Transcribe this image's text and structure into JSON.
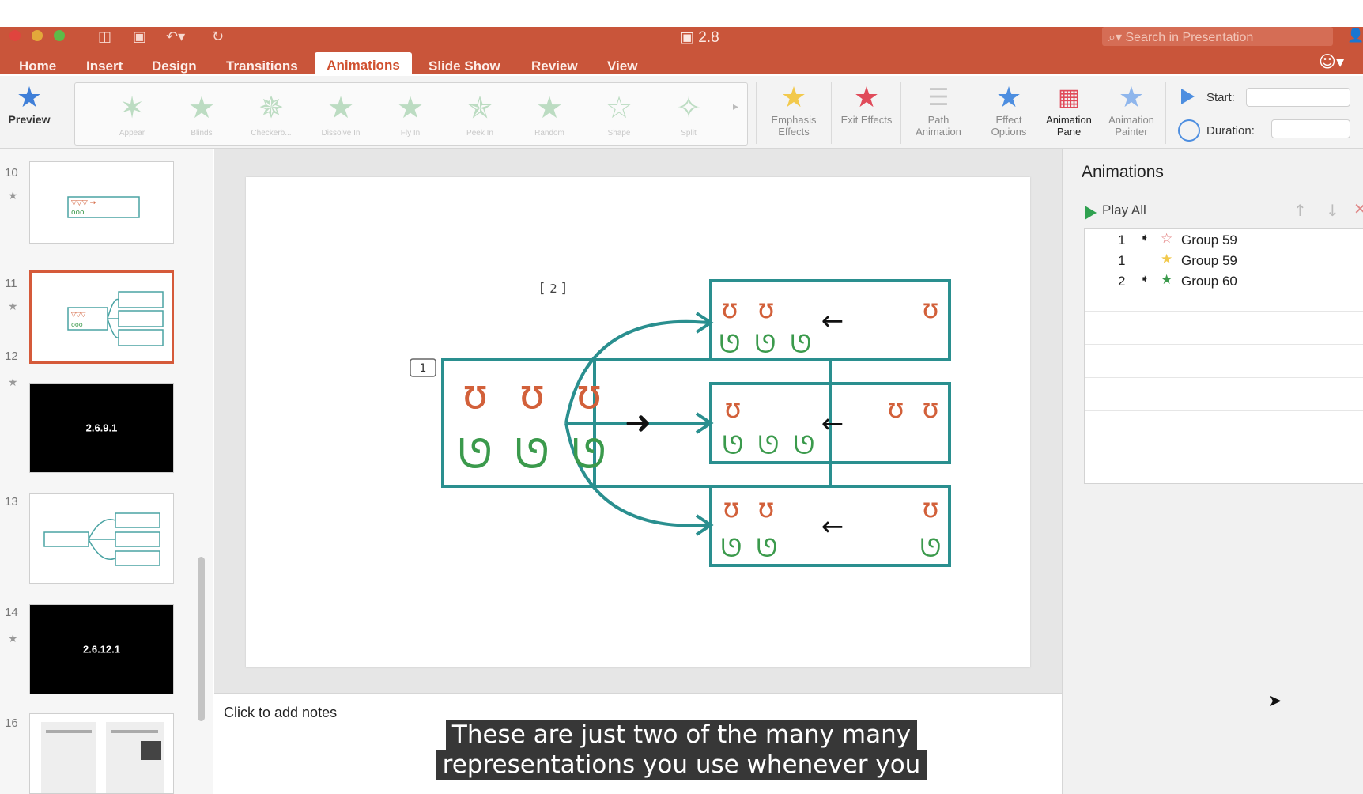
{
  "window": {
    "title": "2.8",
    "search_placeholder": "Search in Presentation"
  },
  "menu_tabs": [
    "Home",
    "Insert",
    "Design",
    "Transitions",
    "Animations",
    "Slide Show",
    "Review",
    "View"
  ],
  "active_tab": "Animations",
  "ribbon": {
    "preview": "Preview",
    "gallery": [
      "Appear",
      "Blinds",
      "Checkerb...",
      "Dissolve In",
      "Fly In",
      "Peek In",
      "Random",
      "Shape",
      "Split"
    ],
    "emphasis": "Emphasis Effects",
    "exit": "Exit Effects",
    "path": "Path Animation",
    "effect_options": "Effect Options",
    "animation_pane": "Animation Pane",
    "animation_painter": "Animation Painter",
    "start_label": "Start:",
    "duration_label": "Duration:"
  },
  "slides": [
    {
      "num": "10",
      "dark": false,
      "text": ""
    },
    {
      "num": "11",
      "dark": false,
      "text": ""
    },
    {
      "num": "12",
      "dark": true,
      "text": "2.6.9.1"
    },
    {
      "num": "13",
      "dark": false,
      "text": ""
    },
    {
      "num": "14",
      "dark": true,
      "text": "2.6.12.1"
    },
    {
      "num": "16",
      "dark": false,
      "text": ""
    }
  ],
  "slide_content": {
    "badge1": "1",
    "badge2": "2"
  },
  "notes_placeholder": "Click to add notes",
  "animation_pane": {
    "title": "Animations",
    "play_all": "Play All",
    "items": [
      {
        "order": "1",
        "name": "Group 59",
        "type": "exit"
      },
      {
        "order": "1",
        "name": "Group 59",
        "type": "emphasis"
      },
      {
        "order": "2",
        "name": "Group 60",
        "type": "entrance"
      }
    ]
  },
  "caption": {
    "line1": "These are just two of the many many",
    "line2": "representations you use whenever you"
  },
  "colors": {
    "ribbon_red": "#c9553a",
    "teal": "#2a8f8f",
    "bear": "#d2603a",
    "sheep": "#3b9a4c"
  }
}
